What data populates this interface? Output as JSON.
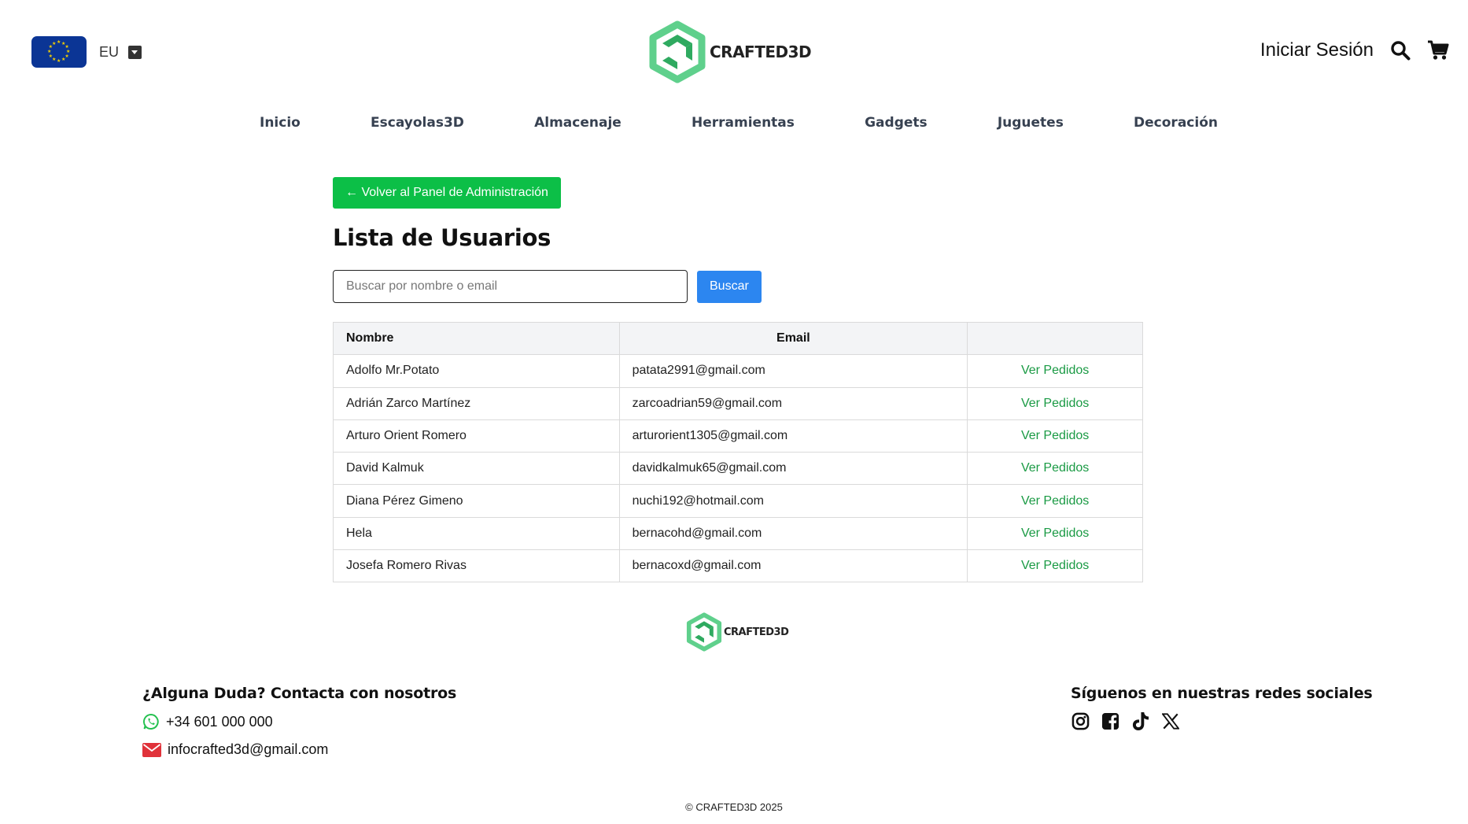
{
  "header": {
    "region_label": "EU",
    "brand_name": "CRAFTED3D",
    "login_label": "Iniciar Sesión",
    "icons": {
      "region": "eu-flag-icon",
      "caret": "caret-down-icon",
      "search": "search-icon",
      "cart": "cart-icon"
    }
  },
  "nav": {
    "items": [
      {
        "label": "Inicio"
      },
      {
        "label": "Escayolas3D"
      },
      {
        "label": "Almacenaje"
      },
      {
        "label": "Herramientas"
      },
      {
        "label": "Gadgets"
      },
      {
        "label": "Juguetes"
      },
      {
        "label": "Decoración"
      }
    ]
  },
  "main": {
    "back_label": "← Volver al Panel de Administración",
    "title": "Lista de Usuarios",
    "search": {
      "placeholder": "Buscar por nombre o email",
      "value": "",
      "button_label": "Buscar"
    },
    "table": {
      "headers": {
        "name": "Nombre",
        "email": "Email",
        "action": ""
      },
      "rows": [
        {
          "name": "Adolfo Mr.Potato",
          "email": "patata2991@gmail.com",
          "action": "Ver Pedidos"
        },
        {
          "name": "Adrián Zarco Martínez",
          "email": "zarcoadrian59@gmail.com",
          "action": "Ver Pedidos"
        },
        {
          "name": "Arturo Orient Romero",
          "email": "arturorient1305@gmail.com",
          "action": "Ver Pedidos"
        },
        {
          "name": "David Kalmuk",
          "email": "davidkalmuk65@gmail.com",
          "action": "Ver Pedidos"
        },
        {
          "name": "Diana Pérez Gimeno",
          "email": "nuchi192@hotmail.com",
          "action": "Ver Pedidos"
        },
        {
          "name": "Hela",
          "email": "bernacohd@gmail.com",
          "action": "Ver Pedidos"
        },
        {
          "name": "Josefa Romero Rivas",
          "email": "bernacoxd@gmail.com",
          "action": "Ver Pedidos"
        }
      ]
    }
  },
  "footer": {
    "brand_name": "CRAFTED3D",
    "contact_heading": "¿Alguna Duda? Contacta con nosotros",
    "phone": "+34 601 000 000",
    "email": "infocrafted3d@gmail.com",
    "social_heading": "Síguenos en nuestras redes sociales",
    "social_icons": [
      "instagram-icon",
      "facebook-icon",
      "tiktok-icon",
      "x-icon"
    ],
    "copyright": "© CRAFTED3D 2025"
  },
  "colors": {
    "back_button": "#0cbf47",
    "search_button": "#2c86f0",
    "link": "#1a9a44",
    "logo_green": "#3dbf73",
    "flag_blue": "#0b3595",
    "whatsapp": "#25c150",
    "mail": "#e0323a"
  }
}
